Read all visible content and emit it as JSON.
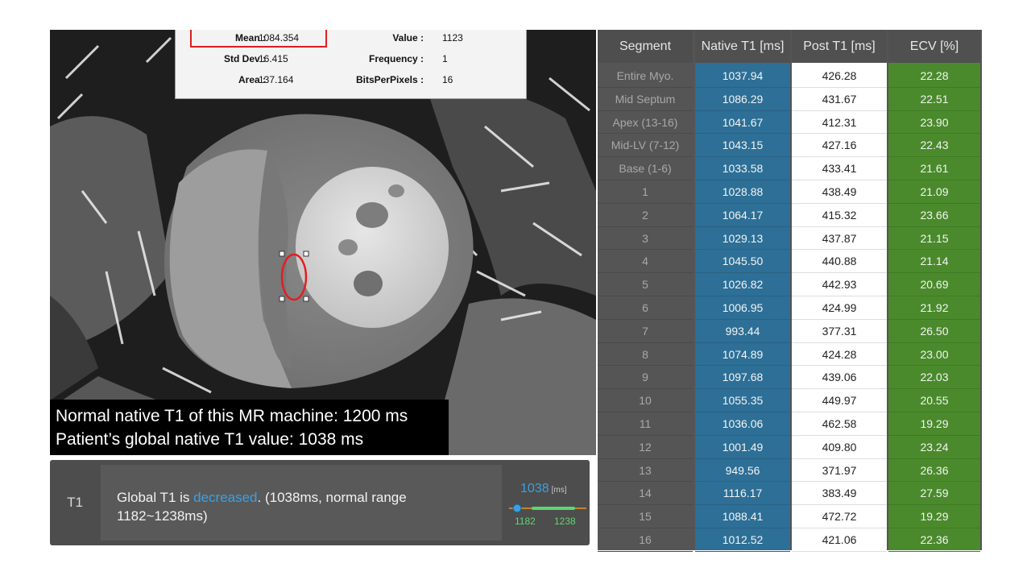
{
  "stats": {
    "mean_label": "Mean :",
    "mean_value": "1084.354",
    "std_label": "Std Dev :",
    "std_value": "16.415",
    "area_label": "Area :",
    "area_value": "137.164",
    "value_label": "Value :",
    "value_value": "1123",
    "frequency_label": "Frequency :",
    "frequency_value": "1",
    "bits_label": "BitsPerPixels :",
    "bits_value": "16"
  },
  "caption": {
    "line1": "Normal native T1 of this MR machine: 1200 ms",
    "line2": "Patient’s global native T1 value: 1038 ms"
  },
  "t1_summary": {
    "label": "T1",
    "text_prefix": "Global T1 is ",
    "text_highlight": "decreased",
    "text_suffix": ". (1038ms, normal range 1182~1238ms)",
    "value": "1038",
    "unit": "[ms]",
    "range_low": "1182",
    "range_high": "1238",
    "colors": {
      "highlight": "#3d9fe0",
      "range": "#5ed670",
      "marker": "#3d9fe0"
    }
  },
  "table": {
    "headers": {
      "segment": "Segment",
      "native": "Native T1 [ms]",
      "post": "Post T1 [ms]",
      "ecv": "ECV [%]"
    },
    "rows": [
      {
        "segment": "Entire Myo.",
        "native": "1037.94",
        "post": "426.28",
        "ecv": "22.28"
      },
      {
        "segment": "Mid Septum",
        "native": "1086.29",
        "post": "431.67",
        "ecv": "22.51"
      },
      {
        "segment": "Apex (13-16)",
        "native": "1041.67",
        "post": "412.31",
        "ecv": "23.90"
      },
      {
        "segment": "Mid-LV (7-12)",
        "native": "1043.15",
        "post": "427.16",
        "ecv": "22.43"
      },
      {
        "segment": "Base (1-6)",
        "native": "1033.58",
        "post": "433.41",
        "ecv": "21.61"
      },
      {
        "segment": "1",
        "native": "1028.88",
        "post": "438.49",
        "ecv": "21.09"
      },
      {
        "segment": "2",
        "native": "1064.17",
        "post": "415.32",
        "ecv": "23.66"
      },
      {
        "segment": "3",
        "native": "1029.13",
        "post": "437.87",
        "ecv": "21.15"
      },
      {
        "segment": "4",
        "native": "1045.50",
        "post": "440.88",
        "ecv": "21.14"
      },
      {
        "segment": "5",
        "native": "1026.82",
        "post": "442.93",
        "ecv": "20.69"
      },
      {
        "segment": "6",
        "native": "1006.95",
        "post": "424.99",
        "ecv": "21.92"
      },
      {
        "segment": "7",
        "native": "993.44",
        "post": "377.31",
        "ecv": "26.50"
      },
      {
        "segment": "8",
        "native": "1074.89",
        "post": "424.28",
        "ecv": "23.00"
      },
      {
        "segment": "9",
        "native": "1097.68",
        "post": "439.06",
        "ecv": "22.03"
      },
      {
        "segment": "10",
        "native": "1055.35",
        "post": "449.97",
        "ecv": "20.55"
      },
      {
        "segment": "11",
        "native": "1036.06",
        "post": "462.58",
        "ecv": "19.29"
      },
      {
        "segment": "12",
        "native": "1001.49",
        "post": "409.80",
        "ecv": "23.24"
      },
      {
        "segment": "13",
        "native": "949.56",
        "post": "371.97",
        "ecv": "26.36"
      },
      {
        "segment": "14",
        "native": "1116.17",
        "post": "383.49",
        "ecv": "27.59"
      },
      {
        "segment": "15",
        "native": "1088.41",
        "post": "472.72",
        "ecv": "19.29"
      },
      {
        "segment": "16",
        "native": "1012.52",
        "post": "421.06",
        "ecv": "22.36"
      }
    ],
    "colors": {
      "native_column": "#2d6f96",
      "post_column": "#ffffff",
      "ecv_column": "#4a8a2c",
      "panel": "#555555"
    }
  },
  "roi": {
    "color": "#e01e22"
  }
}
